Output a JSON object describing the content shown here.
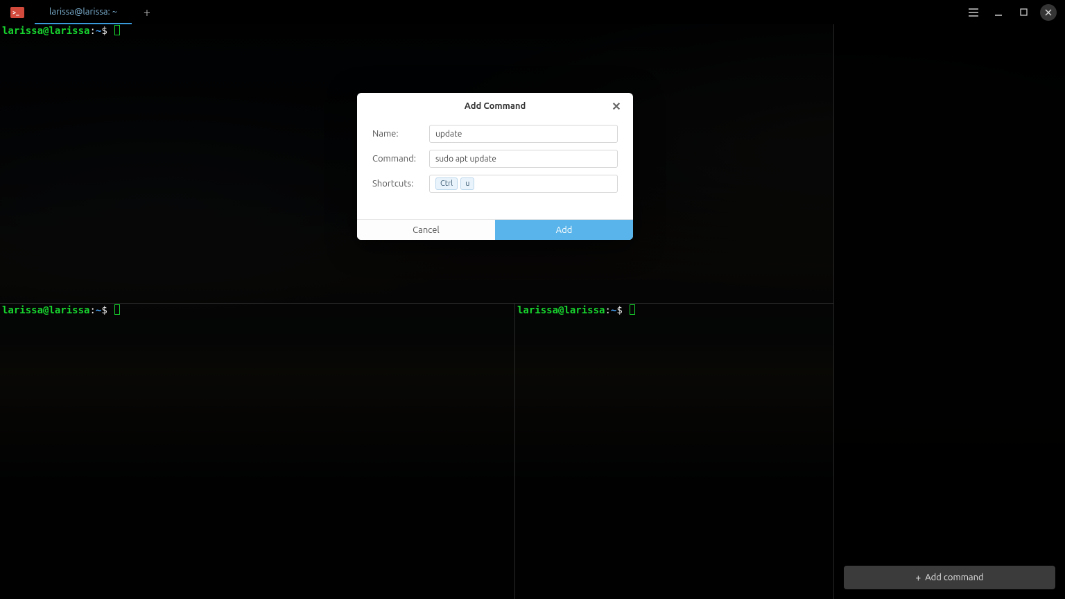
{
  "titlebar": {
    "tab_label": "larissa@larissa: ~",
    "new_tab_glyph": "+"
  },
  "prompt": {
    "user": "larissa",
    "at": "@",
    "host": "larissa",
    "colon": ":",
    "path": "~",
    "dollar": "$"
  },
  "sidebar": {
    "add_command_label": "Add command",
    "plus": "+"
  },
  "dialog": {
    "title": "Add Command",
    "labels": {
      "name": "Name:",
      "command": "Command:",
      "shortcuts": "Shortcuts:"
    },
    "values": {
      "name": "update",
      "command": "sudo apt update"
    },
    "shortcut_keys": [
      "Ctrl",
      "u"
    ],
    "buttons": {
      "cancel": "Cancel",
      "add": "Add"
    }
  }
}
